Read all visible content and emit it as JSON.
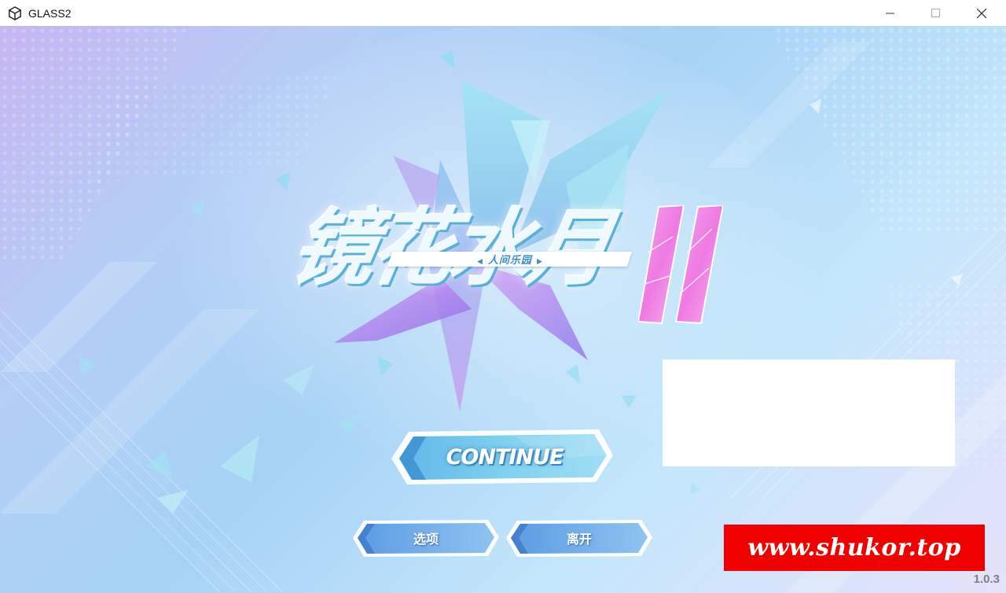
{
  "window": {
    "title": "GLASS2",
    "controls": [
      "minimize",
      "maximize",
      "close"
    ]
  },
  "logo": {
    "title": "镜花水月",
    "numeral": "II",
    "subtitle": "人间乐园"
  },
  "menu": {
    "continue_label": "CONTINUE",
    "options_label": "选项",
    "exit_label": "离开"
  },
  "watermark": "www.shukor.top",
  "version": "1.0.3",
  "colors": {
    "accent_blue": "#4a9ad8",
    "pink": "#f08ae0",
    "watermark_red": "#f00000"
  }
}
